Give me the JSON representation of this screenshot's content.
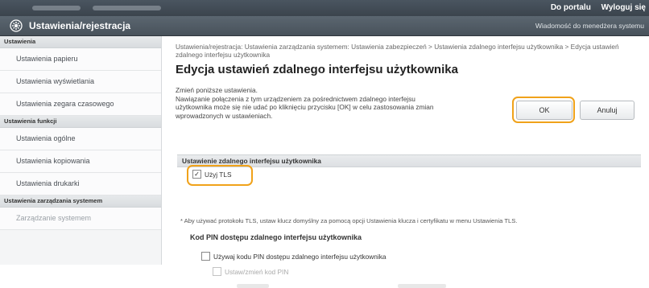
{
  "topbar": {
    "links": {
      "portal": "Do portalu",
      "logout": "Wyloguj się"
    }
  },
  "titlebar": {
    "title": "Ustawienia/rejestracja",
    "manager_link": "Wiadomość do menedżera systemu",
    "icon": "gear-icon"
  },
  "sidebar": {
    "sections": [
      {
        "header": "Ustawienia",
        "items": [
          {
            "label": "Ustawienia papieru"
          },
          {
            "label": "Ustawienia wyświetlania"
          },
          {
            "label": "Ustawienia zegara czasowego"
          }
        ]
      },
      {
        "header": "Ustawienia funkcji",
        "items": [
          {
            "label": "Ustawienia ogólne"
          },
          {
            "label": "Ustawienia kopiowania"
          },
          {
            "label": "Ustawienia drukarki"
          }
        ]
      },
      {
        "header": "Ustawienia zarządzania systemem",
        "items": [
          {
            "label": "Zarządzanie systemem"
          }
        ]
      }
    ]
  },
  "main": {
    "breadcrumb": "Ustawienia/rejestracja: Ustawienia zarządzania systemem: Ustawienia zabezpieczeń > Ustawienia zdalnego interfejsu użytkownika > Edycja ustawień zdalnego interfejsu użytkownika",
    "heading": "Edycja ustawień zdalnego interfejsu użytkownika",
    "description": "Zmień poniższe ustawienia.\nNawiązanie połączenia z tym urządzeniem za pośrednictwem zdalnego interfejsu użytkownika może się nie udać po kliknięciu przycisku [OK] w celu zastosowania zmian wprowadzonych w ustawieniach.",
    "ok_label": "OK",
    "cancel_label": "Anuluj",
    "section_title": "Ustawienie zdalnego interfejsu użytkownika",
    "use_tls_label": "Użyj TLS",
    "use_tls_checked": true,
    "tls_note": "* Aby używać protokołu TLS, ustaw klucz domyślny za pomocą opcji Ustawienia klucza i certyfikatu w menu Ustawienia TLS.",
    "pin_heading": "Kod PIN dostępu zdalnego interfejsu użytkownika",
    "use_pin_label": "Używaj kodu PIN dostępu zdalnego interfejsu użytkownika",
    "use_pin_checked": false,
    "set_pin_label": "Ustaw/zmień kod PIN",
    "set_pin_checked": false
  },
  "colors": {
    "highlight": "#f0a21a",
    "header_bar": "#4a5560"
  }
}
